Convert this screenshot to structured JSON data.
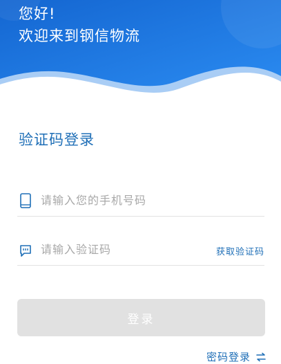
{
  "header": {
    "greeting": "您好!",
    "welcome": "欢迎来到钢信物流"
  },
  "page_title": "验证码登录",
  "phone_field": {
    "icon": "phone-icon",
    "placeholder": "请输入您的手机号码",
    "value": ""
  },
  "code_field": {
    "icon": "message-icon",
    "placeholder": "请输入验证码",
    "value": "",
    "get_code_label": "获取验证码"
  },
  "login_button": {
    "label": "登录",
    "enabled": false
  },
  "password_login": {
    "label": "密码登录",
    "icon": "swap-arrows-icon"
  },
  "colors": {
    "header_blue": "#1a7be0",
    "accent": "#1f6fb7",
    "button_disabled": "#e1e1e1"
  }
}
